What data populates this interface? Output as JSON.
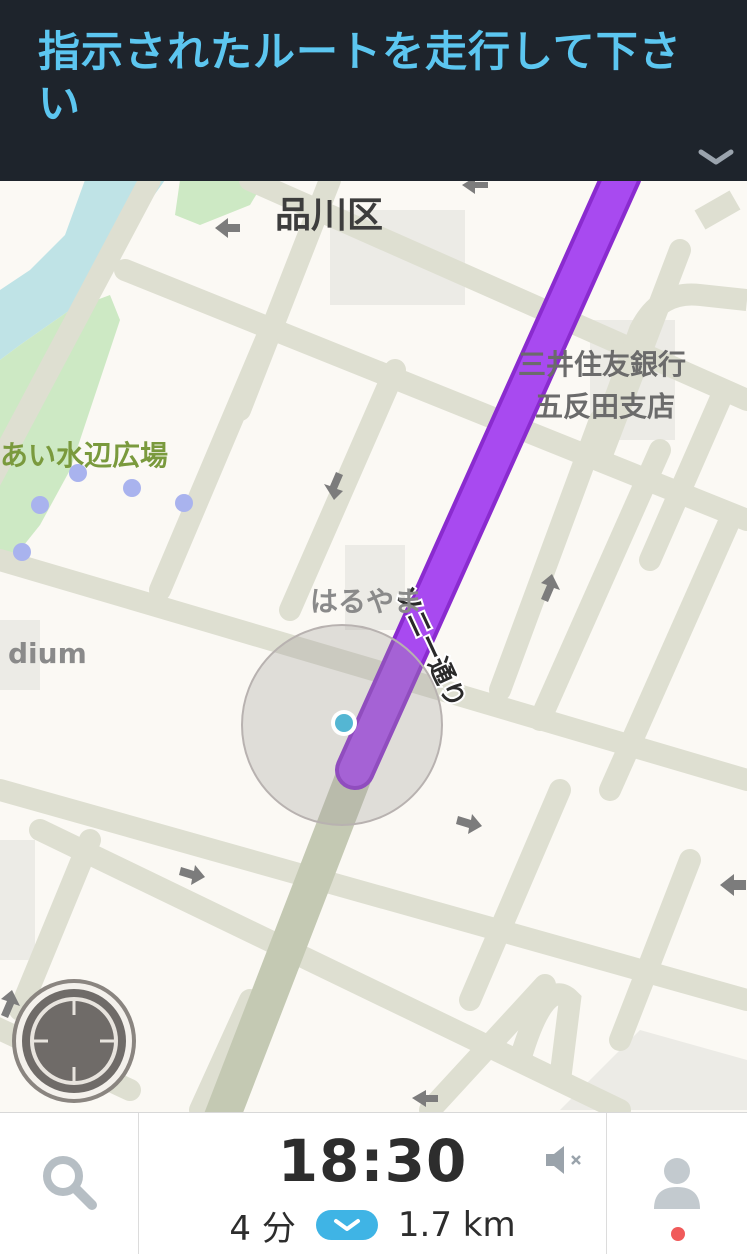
{
  "banner": {
    "instruction": "指示されたルートを走行して下さい"
  },
  "map": {
    "labels": {
      "ward": "品川区",
      "bank_line1": "三井住友銀行",
      "bank_line2": "五反田支店",
      "park": "あい水辺広場",
      "place": "はるやま",
      "stadium_partial": "dium",
      "road_name": "ソニー通り"
    }
  },
  "bottom_bar": {
    "eta_time": "18:30",
    "duration": "4 分",
    "distance": "1.7 km"
  },
  "icons": {
    "search": "search-icon",
    "mute": "speaker-muted-icon",
    "user": "user-icon",
    "recenter": "crosshair-icon",
    "chevron": "chevron-down-icon"
  },
  "colors": {
    "banner_bg": "#1e242c",
    "banner_text": "#5cc6f0",
    "route": "#a33fe8",
    "accent_blue": "#3fb4e5",
    "status_dot": "#f05a5a"
  }
}
